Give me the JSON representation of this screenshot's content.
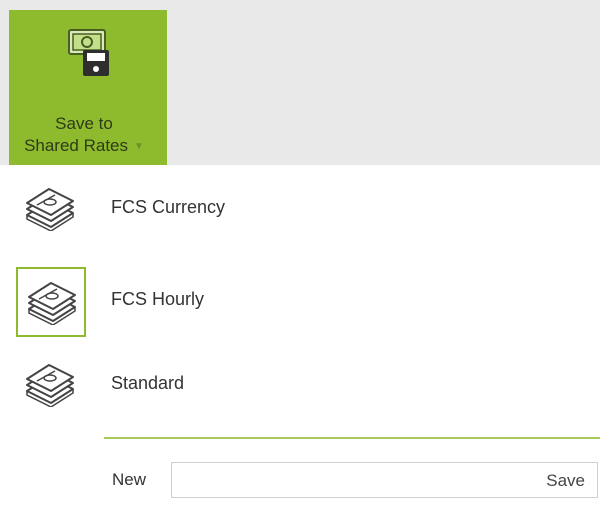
{
  "ribbon": {
    "save_button": {
      "line1": "Save to",
      "line2": "Shared Rates",
      "icon": "money-save-icon",
      "has_dropdown": true
    }
  },
  "menu": {
    "items": [
      {
        "label": "FCS Currency",
        "icon": "money-stack-icon",
        "selected": false
      },
      {
        "label": "FCS Hourly",
        "icon": "money-stack-icon",
        "selected": true
      },
      {
        "label": "Standard",
        "icon": "money-stack-icon",
        "selected": false
      }
    ],
    "new_row": {
      "label": "New",
      "input_value": "",
      "save_label": "Save"
    }
  },
  "colors": {
    "accent": "#8dbb2d",
    "ribbon_bg": "#e9e9e9",
    "separator": "#a8c95a"
  }
}
